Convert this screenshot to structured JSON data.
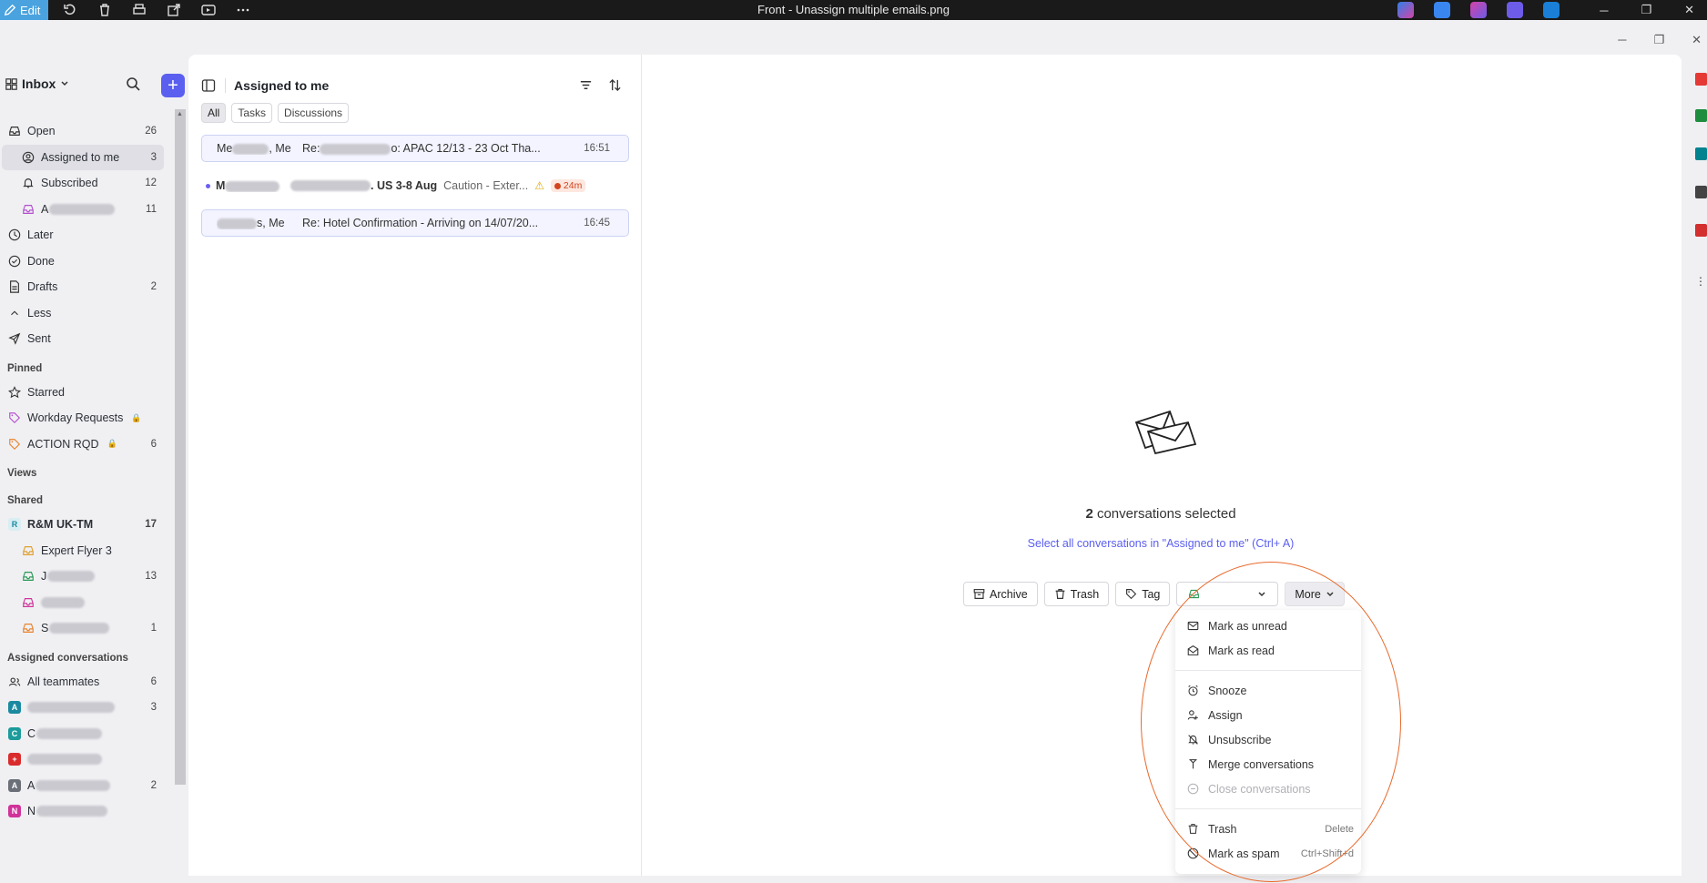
{
  "titlebar": {
    "edit_label": "Edit",
    "title": "Front - Unassign multiple emails.png",
    "app_colors": [
      "#2f7fe8",
      "#3a86f0",
      "#d443a8",
      "#6d5ce8",
      "#1a7fd6"
    ]
  },
  "sidebar": {
    "inbox_label": "Inbox",
    "items": [
      {
        "label": "Open",
        "count": "26",
        "icon": "inbox-icon"
      },
      {
        "label": "Assigned to me",
        "count": "3",
        "icon": "user-circle-icon"
      },
      {
        "label": "Subscribed",
        "count": "12",
        "icon": "bell-icon"
      },
      {
        "label": "A",
        "count": "11",
        "icon": "inbox-icon"
      },
      {
        "label": "Later",
        "count": "",
        "icon": "clock-icon"
      },
      {
        "label": "Done",
        "count": "",
        "icon": "check-circle-icon"
      },
      {
        "label": "Drafts",
        "count": "2",
        "icon": "draft-icon"
      },
      {
        "label": "Less",
        "count": "",
        "icon": "chevron-up-icon"
      },
      {
        "label": "Sent",
        "count": "",
        "icon": "send-icon"
      }
    ],
    "pinned_header": "Pinned",
    "pinned": [
      {
        "label": "Starred",
        "count": ""
      },
      {
        "label": "Workday Requests",
        "count": ""
      },
      {
        "label": "ACTION RQD",
        "count": "6"
      }
    ],
    "views_header": "Views",
    "shared_header": "Shared",
    "shared": [
      {
        "label": "R&M UK-TM",
        "count": "17",
        "avatar": "R"
      },
      {
        "label": "Expert Flyer 3",
        "count": ""
      },
      {
        "label": "J",
        "count": "13"
      },
      {
        "label": "",
        "count": ""
      },
      {
        "label": "S",
        "count": "1"
      }
    ],
    "assigned_header": "Assigned conversations",
    "assigned": [
      {
        "label": "All teammates",
        "count": "6"
      },
      {
        "label": "",
        "count": "3"
      },
      {
        "label": "C",
        "count": ""
      },
      {
        "label": "",
        "count": ""
      },
      {
        "label": "A",
        "count": "2"
      },
      {
        "label": "N",
        "count": ""
      }
    ]
  },
  "list": {
    "title": "Assigned to me",
    "tabs": [
      "All",
      "Tasks",
      "Discussions"
    ],
    "conversations": [
      {
        "from": "Me",
        "from_suffix": ", Me",
        "subject": "Re:",
        "subject_tail": "o: APAC 12/13 - 23 Oct  Tha...",
        "time": "16:51",
        "selected": true
      },
      {
        "from": "M",
        "subject": ". US 3-8 Aug",
        "preview": "Caution - Exter...",
        "badge": "24m",
        "unread": true
      },
      {
        "from": "s, Me",
        "subject": "Re: Hotel Confirmation - Arriving on 14/07/20...",
        "time": "16:45",
        "selected": true
      }
    ]
  },
  "main": {
    "selected_count": "2",
    "selected_label": " conversations selected",
    "select_all_link": "Select all conversations in \"Assigned to me\" (Ctrl+ A)",
    "actions": {
      "archive": "Archive",
      "trash": "Trash",
      "tag": "Tag",
      "more": "More"
    },
    "menu": {
      "mark_unread": "Mark as unread",
      "mark_read": "Mark as read",
      "snooze": "Snooze",
      "assign": "Assign",
      "unsubscribe": "Unsubscribe",
      "merge": "Merge conversations",
      "close": "Close conversations",
      "trash": "Trash",
      "trash_shortcut": "Delete",
      "spam": "Mark as spam",
      "spam_shortcut": "Ctrl+Shift+d"
    }
  }
}
